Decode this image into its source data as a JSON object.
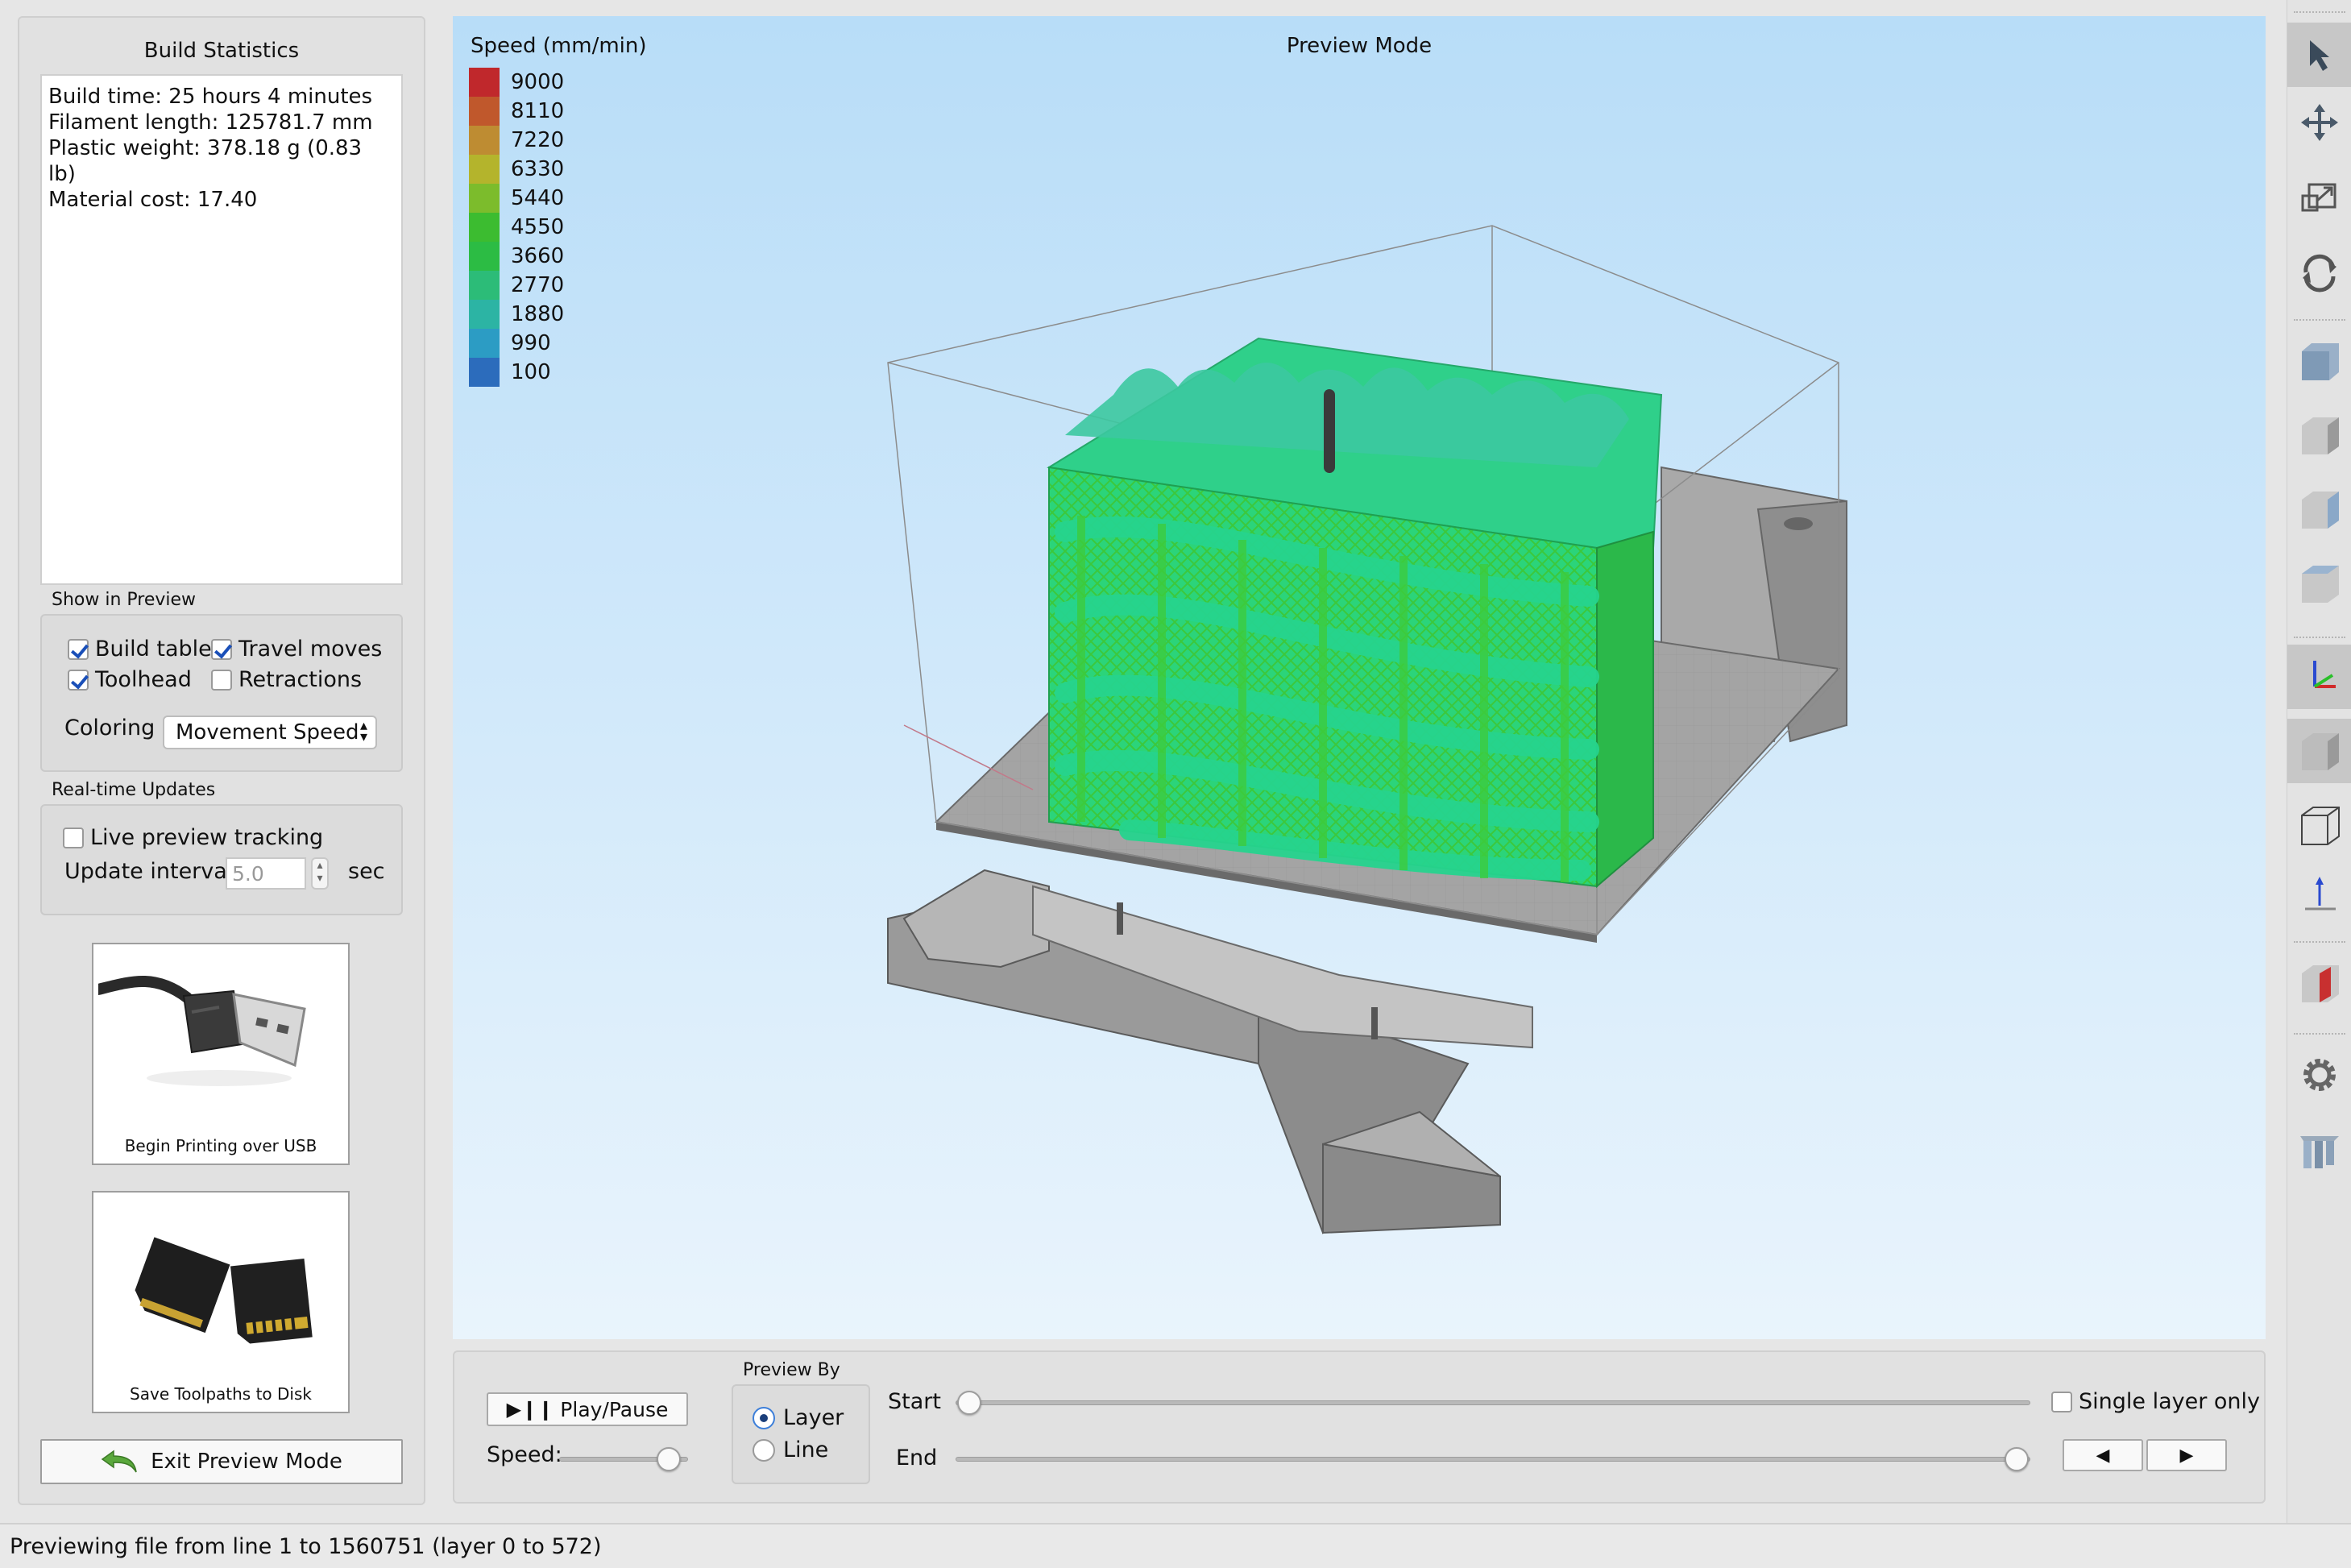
{
  "build_stats": {
    "title": "Build Statistics",
    "lines": [
      "Build time: 25 hours 4 minutes",
      "Filament length: 125781.7 mm",
      "Plastic weight: 378.18 g (0.83 lb)",
      "Material cost: 17.40"
    ]
  },
  "show_in_preview": {
    "label": "Show in Preview",
    "build_table": {
      "label": "Build table",
      "checked": true
    },
    "travel_moves": {
      "label": "Travel moves",
      "checked": true
    },
    "toolhead": {
      "label": "Toolhead",
      "checked": true
    },
    "retractions": {
      "label": "Retractions",
      "checked": false
    },
    "coloring_label": "Coloring",
    "coloring_value": "Movement Speed"
  },
  "realtime": {
    "label": "Real-time Updates",
    "live_tracking": {
      "label": "Live preview tracking",
      "checked": false
    },
    "interval_label": "Update interval",
    "interval_value": "5.0",
    "sec_label": "sec"
  },
  "usb_button": {
    "caption": "Begin Printing over USB"
  },
  "disk_button": {
    "caption": "Save Toolpaths to Disk"
  },
  "exit_button": {
    "label": "Exit Preview Mode"
  },
  "viewport": {
    "title": "Preview Mode",
    "legend_title": "Speed (mm/min)",
    "legend": [
      {
        "value": "9000",
        "color": "#c0282c"
      },
      {
        "value": "8110",
        "color": "#c0582c"
      },
      {
        "value": "7220",
        "color": "#be8c32"
      },
      {
        "value": "6330",
        "color": "#b4b42c"
      },
      {
        "value": "5440",
        "color": "#7cbc2c"
      },
      {
        "value": "4550",
        "color": "#3cbc30"
      },
      {
        "value": "3660",
        "color": "#2cbc44"
      },
      {
        "value": "2770",
        "color": "#2cbc78"
      },
      {
        "value": "1880",
        "color": "#2cb4a4"
      },
      {
        "value": "990",
        "color": "#2c9cc4"
      },
      {
        "value": "100",
        "color": "#2c6cbc"
      }
    ]
  },
  "controls": {
    "play_pause": "Play/Pause",
    "speed_label": "Speed:",
    "preview_by_label": "Preview By",
    "layer_label": "Layer",
    "line_label": "Line",
    "preview_by_selected": "Layer",
    "start_label": "Start",
    "end_label": "End",
    "single_layer": {
      "label": "Single layer only",
      "checked": false
    },
    "speed_value": 0.85,
    "start_value": 0,
    "end_value": 572
  },
  "toolbar": {
    "tools": [
      "select-icon",
      "move-icon",
      "scale-icon",
      "rotate-icon",
      "view-front-icon",
      "view-left-icon",
      "view-right-icon",
      "view-top-icon",
      "axes-icon",
      "solid-view-icon",
      "wireframe-view-icon",
      "z-axis-icon",
      "section-icon",
      "gear-icon",
      "extruders-icon"
    ]
  },
  "status": "Previewing file from line 1 to 1560751 (layer 0 to 572)"
}
